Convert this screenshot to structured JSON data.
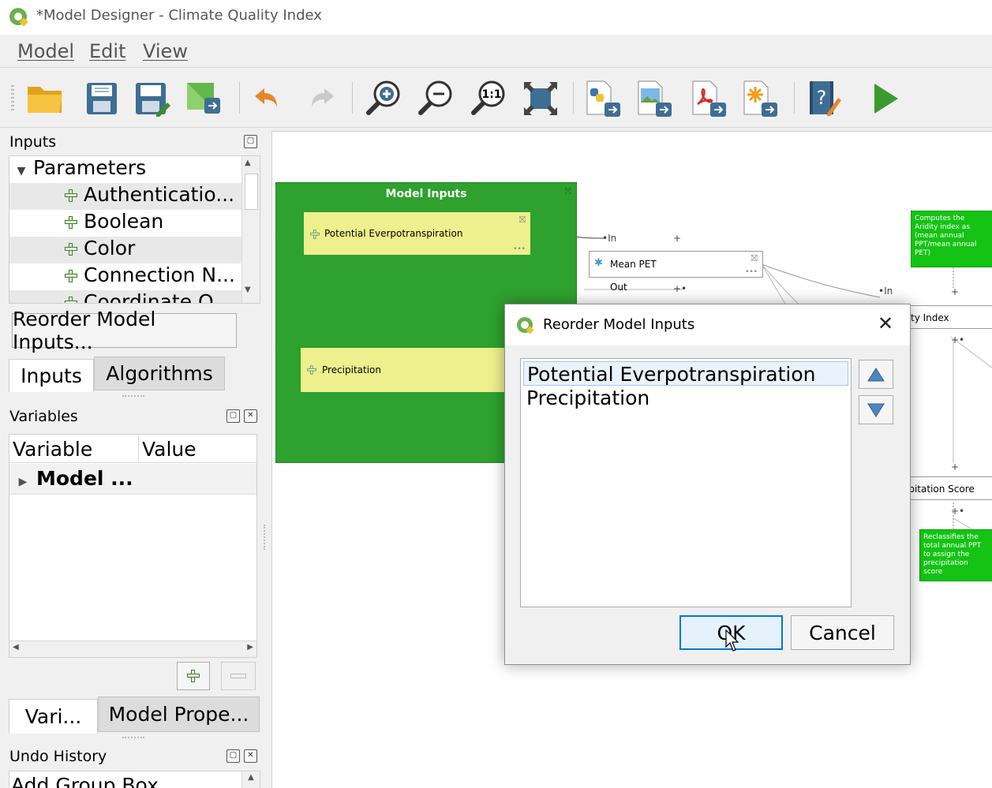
{
  "window": {
    "title": "*Model Designer - Climate Quality Index"
  },
  "menu": {
    "items": [
      "Model",
      "Edit",
      "View"
    ]
  },
  "toolbar": {
    "icons": [
      "open-folder-icon",
      "save-icon",
      "save-as-icon",
      "export-image-icon",
      "undo-icon",
      "redo-icon",
      "zoom-in-icon",
      "zoom-out-icon",
      "zoom-actual-icon",
      "zoom-full-icon",
      "export-python-icon",
      "export-image-file-icon",
      "export-pdf-icon",
      "export-svg-icon",
      "help-edit-icon",
      "run-icon"
    ]
  },
  "inputs_panel": {
    "title": "Inputs",
    "tree_root": "Parameters",
    "items": [
      "Authenticatio...",
      "Boolean",
      "Color",
      "Connection N...",
      "Coordinate O..."
    ],
    "reorder_button": "Reorder Model Inputs...",
    "tabs": [
      "Inputs",
      "Algorithms"
    ]
  },
  "variables_panel": {
    "title": "Variables",
    "columns": [
      "Variable",
      "Value"
    ],
    "rows": [
      "Model ..."
    ],
    "tabs": [
      "Vari...",
      "Model Prope..."
    ]
  },
  "undo_panel": {
    "title": "Undo History",
    "items": [
      "Add Group Box"
    ]
  },
  "canvas": {
    "group_title": "Model Inputs",
    "inputs": [
      "Potential Everpotranspiration",
      "Precipitation"
    ],
    "algorithm": "Mean PET",
    "port_in": "In",
    "port_out": "Out",
    "aridity_partial": "ty Index",
    "precip_score_partial": "ipitation Score",
    "comment1": "Computes the Aridity index as (mean annual PPT/mean annual PET)",
    "comment2": "Reclassifies the total annual PPT to assign the precipitation score",
    "colors": {
      "group": "#2ea12e",
      "input_node": "#eef08e",
      "comment": "#14c314"
    }
  },
  "dialog": {
    "title": "Reorder Model Inputs",
    "items": [
      "Potential Everpotranspiration",
      "Precipitation"
    ],
    "selected_index": 0,
    "ok": "OK",
    "cancel": "Cancel"
  }
}
